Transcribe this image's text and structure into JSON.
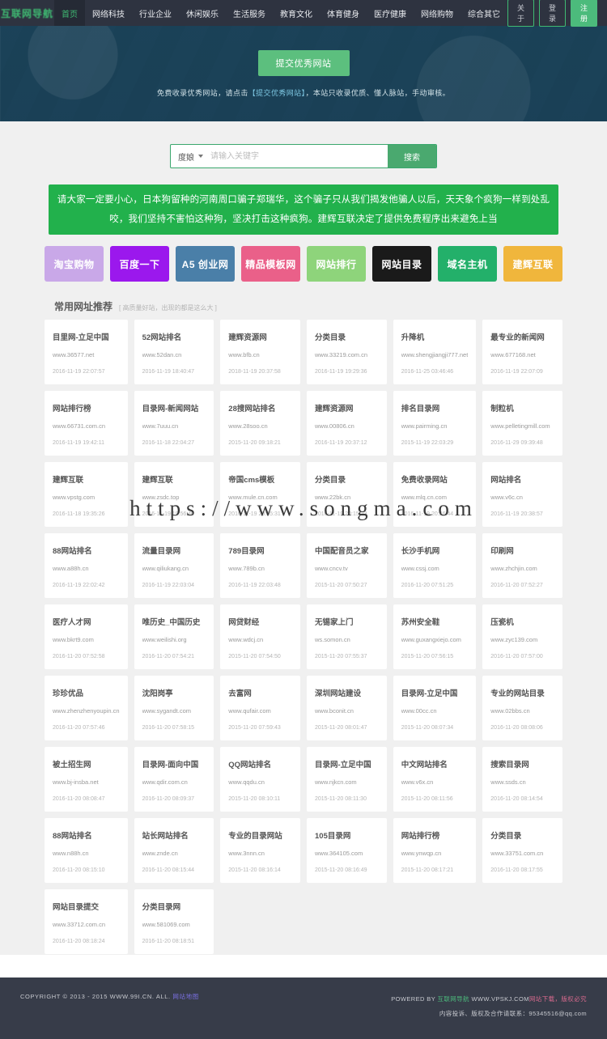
{
  "nav": {
    "brand": "互联网导航",
    "items": [
      {
        "label": "首页",
        "active": true
      },
      {
        "label": "网络科技",
        "active": false
      },
      {
        "label": "行业企业",
        "active": false
      },
      {
        "label": "休闲娱乐",
        "active": false
      },
      {
        "label": "生活服务",
        "active": false
      },
      {
        "label": "教育文化",
        "active": false
      },
      {
        "label": "体育健身",
        "active": false
      },
      {
        "label": "医疗健康",
        "active": false
      },
      {
        "label": "网络购物",
        "active": false
      },
      {
        "label": "综合其它",
        "active": false
      }
    ],
    "buttons": [
      {
        "label": "关于",
        "style": "outline"
      },
      {
        "label": "登录",
        "style": "outline"
      },
      {
        "label": "注册",
        "style": "solid"
      }
    ]
  },
  "hero": {
    "submit_button": "提交优秀网站",
    "note_before": "免费收录优秀网站，请点击",
    "note_link": "【提交优秀网站】",
    "note_after": "，本站只收录优质、懂人脉站，手动审核。"
  },
  "search": {
    "engine": "度娘",
    "placeholder": "请输入关键字",
    "value": "",
    "button": "搜索"
  },
  "notice": {
    "text": "请大家一定要小心，日本狗留种的河南周口骗子郑瑞华，这个骗子只从我们揭发他骗人以后，天天象个疯狗一样到处乱咬，我们坚持不害怕这种狗，坚决打击这种疯狗。建辉互联决定了提供免费程序出来避免上当",
    "bg": "#22b14c"
  },
  "quick_links": [
    {
      "label": "淘宝购物",
      "color": "#c9a8e8"
    },
    {
      "label": "百度一下",
      "color": "#9b18ed"
    },
    {
      "label": "A5 创业网",
      "color": "#4a7fa8"
    },
    {
      "label": "精品模板网",
      "color": "#ea6089"
    },
    {
      "label": "网站排行",
      "color": "#8ed47b"
    },
    {
      "label": "网站目录",
      "color": "#1a1a1a"
    },
    {
      "label": "域名主机",
      "color": "#23b06a"
    },
    {
      "label": "建辉互联",
      "color": "#f0b63c"
    }
  ],
  "section": {
    "title": "常用网址推荐",
    "subtitle": "[ 高质量好站，出现的都是这么大 ]"
  },
  "watermark": "https://www.songma.com",
  "sites": [
    {
      "title": "目里网-立足中国",
      "url": "www.36577.net",
      "date": "2016-11-19 22:07:57"
    },
    {
      "title": "52网站排名",
      "url": "www.52dan.cn",
      "date": "2016-11-19 18:40:47"
    },
    {
      "title": "建辉资源网",
      "url": "www.bfb.cn",
      "date": "2018-11-19 20:37:58"
    },
    {
      "title": "分类目录",
      "url": "www.33219.com.cn",
      "date": "2016-11-19 19:29:36"
    },
    {
      "title": "升降机",
      "url": "www.shengjiangji777.net",
      "date": "2016-11-25 03:46:46"
    },
    {
      "title": "最专业的新闻网",
      "url": "www.677168.net",
      "date": "2016-11-19 22:07:09"
    },
    {
      "title": "网站排行榜",
      "url": "www.66731.com.cn",
      "date": "2016-11-19 19:42:11"
    },
    {
      "title": "目录网-新闻网站",
      "url": "www.7uuu.cn",
      "date": "2016-11-18 22:04:27"
    },
    {
      "title": "28搜网站排名",
      "url": "www.28soo.cn",
      "date": "2015-11-20 09:18:21"
    },
    {
      "title": "建辉资源网",
      "url": "www.00806.cn",
      "date": "2016-11-19 20:37:12"
    },
    {
      "title": "排名目录网",
      "url": "www.pairming.cn",
      "date": "2015-11-19 22:03:29"
    },
    {
      "title": "制粒机",
      "url": "www.pelletingmill.com",
      "date": "2016-11-29 09:39:48"
    },
    {
      "title": "建辉互联",
      "url": "www.vpstg.com",
      "date": "2016-11-18 19:35:26"
    },
    {
      "title": "建辉互联",
      "url": "www.zsdc.top",
      "date": "2016-11-19 19:56:40"
    },
    {
      "title": "帝国cms模板",
      "url": "www.mule.cn.com",
      "date": "2016-11-19 20:05:31"
    },
    {
      "title": "分类目录",
      "url": "www.22bk.cn",
      "date": "2016-11-19 20:15:23"
    },
    {
      "title": "免费收录网站",
      "url": "www.mlq.cn.com",
      "date": "2016-11-19 20:26:44"
    },
    {
      "title": "网站排名",
      "url": "www.v6c.cn",
      "date": "2016-11-19 20:38:57"
    },
    {
      "title": "88网站排名",
      "url": "www.a88h.cn",
      "date": "2016-11-19 22:02:42"
    },
    {
      "title": "流量目录网",
      "url": "www.qiliukang.cn",
      "date": "2016-11-19 22:03:04"
    },
    {
      "title": "789目录网",
      "url": "www.789b.cn",
      "date": "2016-11-19 22:03:48"
    },
    {
      "title": "中国配音员之家",
      "url": "www.cncv.tv",
      "date": "2015-11-20 07:50:27"
    },
    {
      "title": "长沙手机网",
      "url": "www.cssj.com",
      "date": "2016-11-20 07:51:25"
    },
    {
      "title": "印刷网",
      "url": "www.zhchjin.com",
      "date": "2016-11-20 07:52:27"
    },
    {
      "title": "医疗人才网",
      "url": "www.bkrt9.com",
      "date": "2016-11-20 07:52:58"
    },
    {
      "title": "唯历史_中国历史",
      "url": "www.weilishi.org",
      "date": "2016-11-20 07:54:21"
    },
    {
      "title": "网贷财经",
      "url": "www.wdcj.cn",
      "date": "2015-11-20 07:54:50"
    },
    {
      "title": "无锡家上门",
      "url": "ws.somon.cn",
      "date": "2015-11-20 07:55:37"
    },
    {
      "title": "苏州安全鞋",
      "url": "www.guxangxiejo.com",
      "date": "2015-11-20 07:56:15"
    },
    {
      "title": "压瓷机",
      "url": "www.zyc139.com",
      "date": "2016-11-20 07:57:00"
    },
    {
      "title": "珍珍优品",
      "url": "www.zhenzhenyoupin.cn",
      "date": "2016-11-20 07:57:46"
    },
    {
      "title": "沈阳岗亭",
      "url": "www.sygandt.com",
      "date": "2016-11-20 07:58:15"
    },
    {
      "title": "去富网",
      "url": "www.qufair.com",
      "date": "2015-11-20 07:59:43"
    },
    {
      "title": "深圳网站建设",
      "url": "www.bconit.cn",
      "date": "2015-11-20 08:01:47"
    },
    {
      "title": "目录网-立足中国",
      "url": "www.00cc.cn",
      "date": "2015-11-20 08:07:34"
    },
    {
      "title": "专业的网站目录",
      "url": "www.02bbs.cn",
      "date": "2016-11-20 08:08:06"
    },
    {
      "title": "被土招生网",
      "url": "www.bj-insba.net",
      "date": "2016-11-20 08:08:47"
    },
    {
      "title": "目录网-面向中国",
      "url": "www.qdir.com.cn",
      "date": "2016-11-20 08:09:37"
    },
    {
      "title": "QQ网站排名",
      "url": "www.qqdu.cn",
      "date": "2015-11-20 08:10:11"
    },
    {
      "title": "目录网-立足中国",
      "url": "www.njkcn.com",
      "date": "2015-11-20 08:11:30"
    },
    {
      "title": "中文网站排名",
      "url": "www.v6x.cn",
      "date": "2015-11-20 08:11:56"
    },
    {
      "title": "搜索目录网",
      "url": "www.ssds.cn",
      "date": "2016-11-20 08:14:54"
    },
    {
      "title": "88网站排名",
      "url": "www.n88h.cn",
      "date": "2016-11-20 08:15:10"
    },
    {
      "title": "站长网站排名",
      "url": "www.znde.cn",
      "date": "2016-11-20 08:15:44"
    },
    {
      "title": "专业的目录网站",
      "url": "www.3nnn.cn",
      "date": "2015-11-20 08:16:14"
    },
    {
      "title": "105目录网",
      "url": "www.364105.com",
      "date": "2015-11-20 08:16:49"
    },
    {
      "title": "网站排行榜",
      "url": "www.ynwqp.cn",
      "date": "2015-11-20 08:17:21"
    },
    {
      "title": "分类目录",
      "url": "www.33751.com.cn",
      "date": "2016-11-20 08:17:55"
    },
    {
      "title": "网站目录提交",
      "url": "www.33712.com.cn",
      "date": "2016-11-20 08:18:24"
    },
    {
      "title": "分类目录网",
      "url": "www.581069.com",
      "date": "2016-11-20 08:18:51"
    }
  ],
  "footer": {
    "copyright_prefix": "COPYRIGHT © 2013 - 2015 WWW.99I.CN. ALL.",
    "copyright_link": "网站地图",
    "powered_prefix": "POWERED BY",
    "powered_brand": "互联网导航",
    "powered_suffix": "WWW.VPSKJ.COM",
    "powered_tail": "网站下载，版权必究",
    "contact": "内容投诉、版权及合作请联系：95345516@qq.com"
  }
}
